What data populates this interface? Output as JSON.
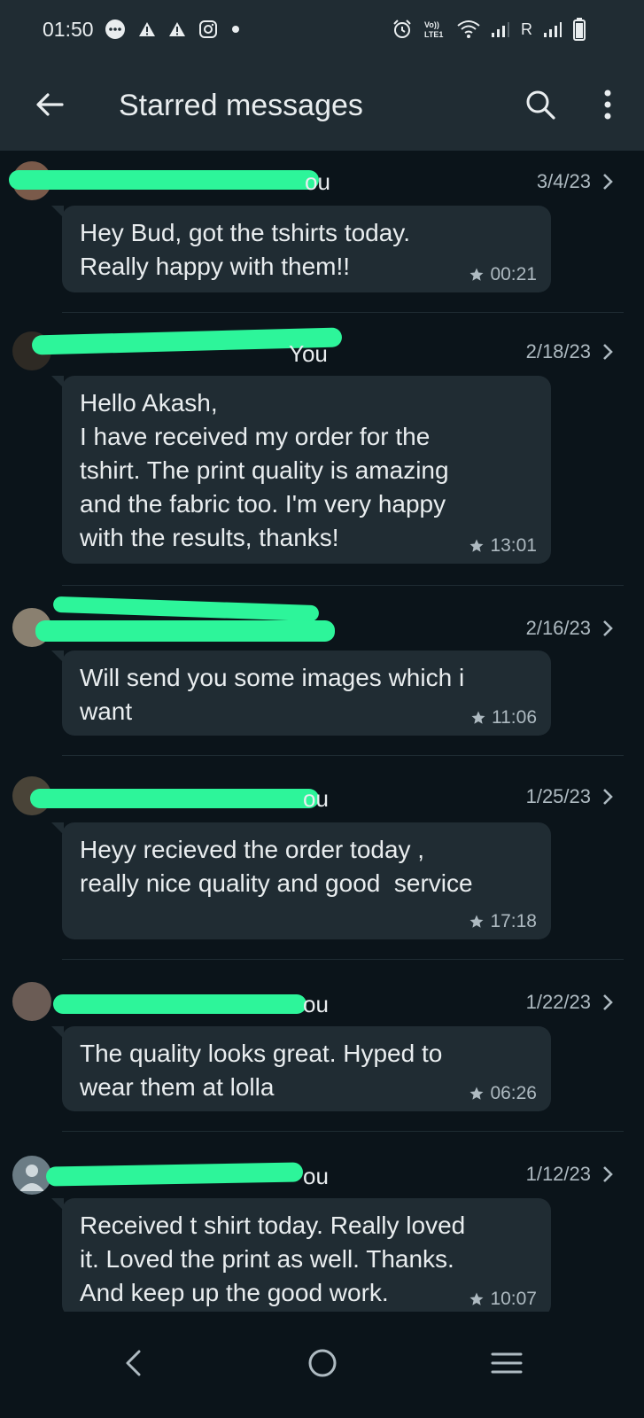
{
  "status_bar": {
    "time": "01:50",
    "left_icons": [
      "chat-bubble-icon",
      "warning-icon",
      "warning-icon",
      "instagram-icon",
      "dot-icon"
    ],
    "right_icons": [
      "alarm-icon",
      "volte-icon",
      "wifi-icon",
      "signal-icon",
      "roaming-signal-icon",
      "battery-icon"
    ],
    "volte_label": "Vo))\nLTE1",
    "roaming_label": "R"
  },
  "app_bar": {
    "title": "Starred messages",
    "back_icon": "arrow-left-icon",
    "search_icon": "search-icon",
    "menu_icon": "more-vert-icon"
  },
  "messages": [
    {
      "sender_suffix": "ou",
      "date": "3/4/23",
      "text": "Hey Bud, got the tshirts today.\nReally happy with them!!",
      "time": "00:21",
      "avatar_color": "#7a5a4a"
    },
    {
      "sender_suffix": "You",
      "date": "2/18/23",
      "text": "Hello Akash,\nI have received my order for the\ntshirt. The print quality is amazing\nand the fabric too. I'm very happy\nwith the results, thanks!",
      "time": "13:01",
      "avatar_color": "#2e2a24"
    },
    {
      "sender_suffix": "",
      "date": "2/16/23",
      "text": "Will send you some images which i\nwant",
      "time": "11:06",
      "avatar_color": "#8a8070"
    },
    {
      "sender_suffix": "ou",
      "date": "1/25/23",
      "text": "Heyy recieved the order today ,\nreally nice quality and good  service",
      "time": "17:18",
      "avatar_color": "#4a4438"
    },
    {
      "sender_suffix": "ou",
      "date": "1/22/23",
      "text": "The quality looks great. Hyped to\nwear them at lolla",
      "time": "06:26",
      "avatar_color": "#6b5c55"
    },
    {
      "sender_suffix": "ou",
      "date": "1/12/23",
      "text": "Received t shirt today. Really loved\nit. Loved the print as well. Thanks.\nAnd keep up the good work.",
      "time": "10:07",
      "avatar_color": "#6b7c85"
    }
  ],
  "nav_bar": {
    "back_icon": "nav-back-icon",
    "home_icon": "nav-home-icon",
    "recents_icon": "nav-recents-icon"
  },
  "colors": {
    "background": "#0b141a",
    "bar": "#202c33",
    "bubble": "#202c33",
    "redaction": "#2df59a",
    "secondary_text": "#aebac1"
  }
}
